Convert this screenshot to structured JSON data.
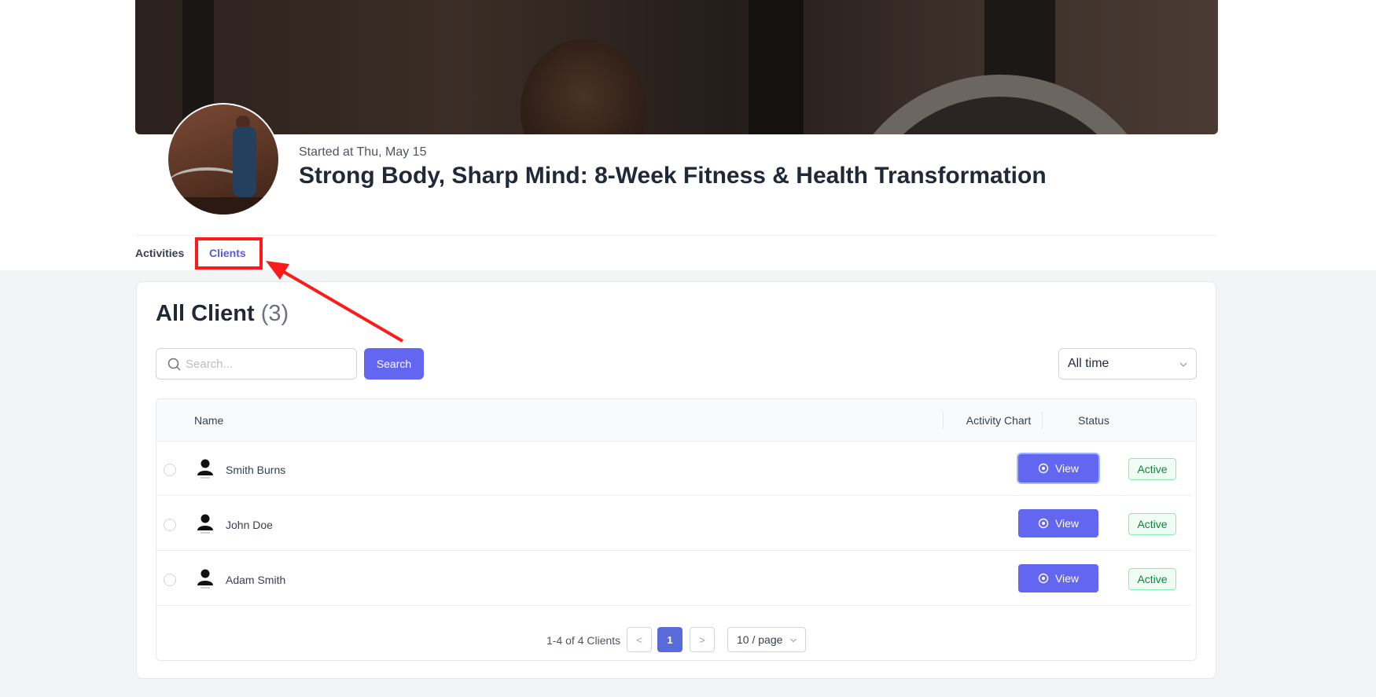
{
  "header": {
    "started": "Started at Thu, May 15",
    "title": "Strong Body, Sharp Mind: 8-Week Fitness & Health Transformation"
  },
  "tabs": {
    "activities": "Activities",
    "clients": "Clients",
    "active_tab": "Clients"
  },
  "clients": {
    "title": "All Client",
    "count": "(3)",
    "search_placeholder": "Search...",
    "search_button": "Search",
    "time_filter": "All time",
    "columns": {
      "name": "Name",
      "activity_chart": "Activity Chart",
      "status": "Status"
    },
    "rows": [
      {
        "name": "Smith Burns",
        "action": "View",
        "status": "Active"
      },
      {
        "name": "John Doe",
        "action": "View",
        "status": "Active"
      },
      {
        "name": "Adam Smith",
        "action": "View",
        "status": "Active"
      }
    ],
    "pagination": {
      "total": "1-4 of 4 Clients",
      "prev": "<",
      "current_page": "1",
      "next": ">",
      "page_size": "10 / page"
    }
  },
  "colors": {
    "accent": "#6366f1",
    "active_tab": "#5b5bd6",
    "status_active": "#15803d",
    "annotation": "#ff1a1a"
  },
  "icons": {
    "search": "search-icon",
    "view": "eye-circle-icon",
    "user": "user-icon",
    "chevron": "chevron-down-icon"
  }
}
